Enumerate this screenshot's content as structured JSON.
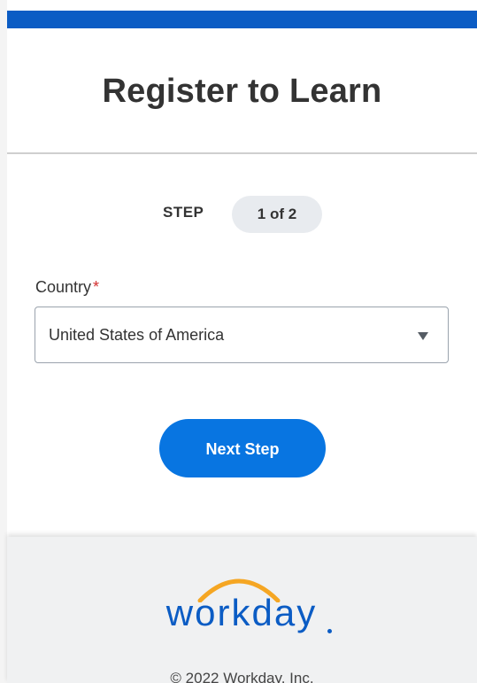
{
  "header": {
    "title": "Register to Learn"
  },
  "step": {
    "label": "STEP",
    "progress": "1 of 2"
  },
  "form": {
    "country_label": "Country",
    "required_marker": "*",
    "country_value": "United States of America"
  },
  "actions": {
    "next_label": "Next Step"
  },
  "footer": {
    "logo_text": "workday",
    "copyright": "© 2022 Workday, Inc."
  },
  "colors": {
    "brand_blue": "#0b5cc4",
    "button_blue": "#0875e1",
    "logo_arc_orange": "#f5a623",
    "required_red": "#d32f2f"
  }
}
